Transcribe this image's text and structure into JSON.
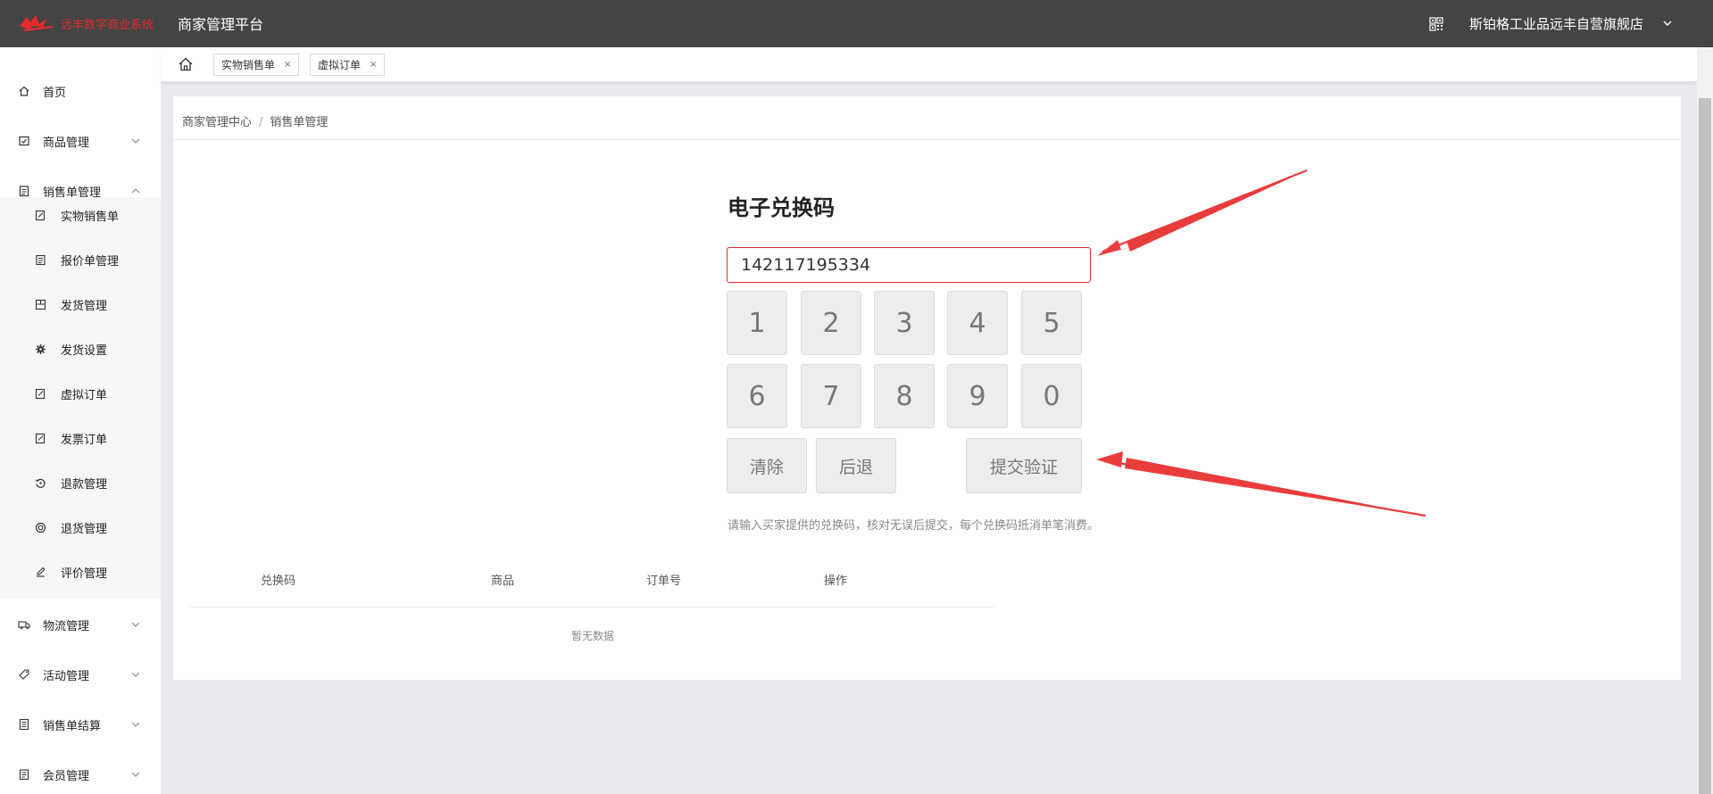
{
  "header": {
    "logo_text": "远丰数字商业系统",
    "platform_title": "商家管理平台",
    "store_name": "斯铂格工业品远丰自营旗舰店"
  },
  "sidebar": {
    "items": [
      {
        "label": "首页"
      },
      {
        "label": "商品管理"
      },
      {
        "label": "销售单管理"
      },
      {
        "label": "物流管理"
      },
      {
        "label": "活动管理"
      },
      {
        "label": "销售单结算"
      },
      {
        "label": "会员管理"
      }
    ],
    "sub_items": [
      {
        "label": "实物销售单"
      },
      {
        "label": "报价单管理"
      },
      {
        "label": "发货管理"
      },
      {
        "label": "发货设置"
      },
      {
        "label": "虚拟订单"
      },
      {
        "label": "发票订单"
      },
      {
        "label": "退款管理"
      },
      {
        "label": "退货管理"
      },
      {
        "label": "评价管理"
      }
    ]
  },
  "tabs": [
    {
      "label": "实物销售单",
      "close": "×"
    },
    {
      "label": "虚拟订单",
      "close": "×"
    }
  ],
  "breadcrumb": {
    "root": "商家管理中心",
    "separator": "/",
    "current": "销售单管理"
  },
  "redeem": {
    "title": "电子兑换码",
    "input_value": "142117195334",
    "keys": [
      "1",
      "2",
      "3",
      "4",
      "5",
      "6",
      "7",
      "8",
      "9",
      "0"
    ],
    "clear_label": "清除",
    "back_label": "后退",
    "submit_label": "提交验证",
    "hint": "请输入买家提供的兑换码，核对无误后提交，每个兑换码抵消单笔消费。"
  },
  "table": {
    "headers": [
      "兑换码",
      "商品",
      "订单号",
      "操作"
    ],
    "empty_text": "暂无数据"
  },
  "colors": {
    "topbar": "#444444",
    "accent_red": "#e93c3c",
    "input_border": "#d9302f"
  }
}
